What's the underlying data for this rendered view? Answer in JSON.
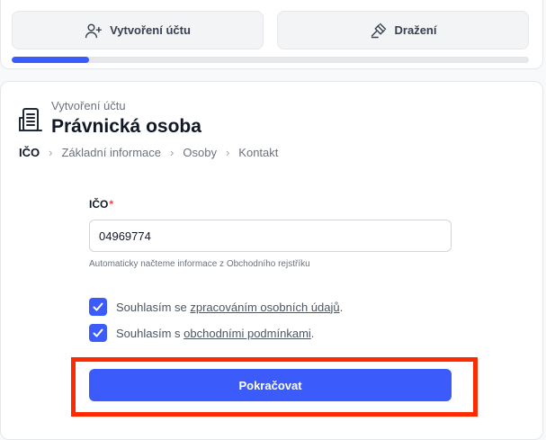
{
  "tabs": [
    {
      "label": "Vytvoření účtu",
      "icon": "user-plus-icon"
    },
    {
      "label": "Dražení",
      "icon": "gavel-icon"
    }
  ],
  "progress": {
    "fraction": 0.15,
    "color": "#3b5bfa"
  },
  "header": {
    "subtitle": "Vytvoření účtu",
    "title": "Právnická osoba",
    "icon": "building-icon"
  },
  "breadcrumb": [
    "IČO",
    "Základní informace",
    "Osoby",
    "Kontakt"
  ],
  "form": {
    "ico_label": "IČO",
    "required_mark": "*",
    "ico_value": "04969774",
    "hint": "Automaticky načteme informace z Obchodního rejstříku"
  },
  "consents": [
    {
      "prefix": "Souhlasím se ",
      "link": "zpracováním osobních údajů",
      "suffix": ".",
      "checked": true
    },
    {
      "prefix": "Souhlasím s ",
      "link": "obchodními podmínkami",
      "suffix": ".",
      "checked": true
    }
  ],
  "submit_label": "Pokračovat",
  "colors": {
    "accent": "#3b5bfa",
    "highlight": "#ff2a00",
    "required": "#ef4444"
  }
}
